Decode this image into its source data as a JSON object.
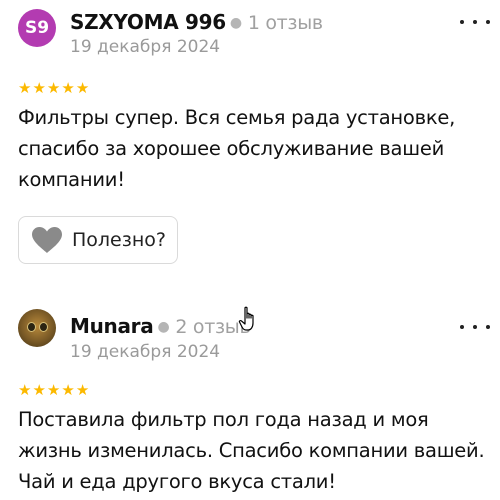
{
  "reviews": [
    {
      "avatar_initials": "S9",
      "avatar_color": "#b33bb1",
      "author": "SZXYOMA 996",
      "review_count": "1 отзыв",
      "date": "19 декабря 2024",
      "rating": 5,
      "text": "Фильтры супер. Вся семья рада установке, спасибо за хорошее обслуживание вашей компании!",
      "helpful_label": "Полезно?",
      "helpful_icon": "heart-icon",
      "more_icon": "more-dots-icon"
    },
    {
      "avatar_type": "photo",
      "author": "Munara",
      "review_count": "2 отзыв",
      "date": "19 декабря 2024",
      "rating": 5,
      "text": "Поставила фильтр пол года назад и моя жизнь изменилась. Спасибо компании вашей. Чай и еда другого вкуса стали!",
      "more_icon": "more-dots-icon"
    }
  ],
  "colors": {
    "star": "#fcb900",
    "secondary_text": "#9a9a9a",
    "border": "#dadada"
  },
  "cursor": "hand-pointer-icon"
}
